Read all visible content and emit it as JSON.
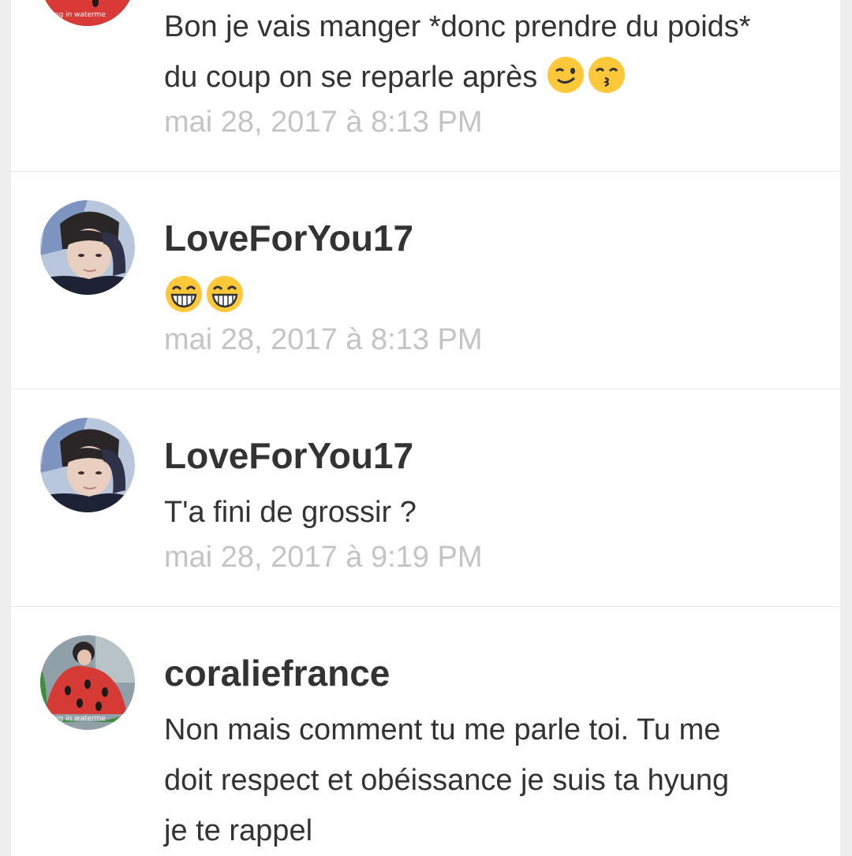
{
  "comments": [
    {
      "text_line1": "Bon je vais manger *donc prendre du poids*",
      "text_line2": "du coup on se reparle après",
      "emojis": [
        "winking-face-icon",
        "kissing-face-icon"
      ],
      "timestamp": "mai 28, 2017 à 8:13 PM",
      "avatar_watermark": "ying in waterme"
    },
    {
      "username": "LoveForYou17",
      "emojis": [
        "laughing-face-icon",
        "laughing-face-icon"
      ],
      "timestamp": "mai 28, 2017 à 8:13 PM"
    },
    {
      "username": "LoveForYou17",
      "text": "T'a fini de grossir ?",
      "timestamp": "mai 28, 2017 à 9:19 PM"
    },
    {
      "username": "coraliefrance",
      "text_line1": "Non mais comment tu me parle toi. Tu me",
      "text_line2": "doit respect et obéissance je suis ta hyung",
      "text_line3": "je te rappel",
      "avatar_watermark": "ying in waterme"
    }
  ],
  "colors": {
    "text": "#333333",
    "timestamp": "#c4c4c4",
    "divider": "#e3e3e3",
    "background": "#eeeeee",
    "card": "#ffffff",
    "emoji": "#ffc83a"
  }
}
